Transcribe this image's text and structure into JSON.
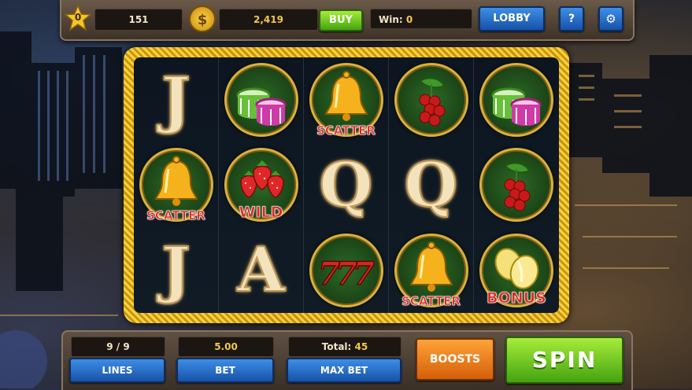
{
  "top_bar": {
    "level": "0",
    "stars": "151",
    "coins": "2,419",
    "buy_label": "BUY",
    "win_label": "Win:",
    "win_value": "0",
    "lobby_label": "LOBBY",
    "help_label": "?",
    "settings_icon": "gear-icon"
  },
  "reels": {
    "rows": [
      [
        "J",
        "chips",
        "bell",
        "cherries",
        "chips"
      ],
      [
        "bell",
        "strawberries",
        "Q",
        "Q",
        "cherries"
      ],
      [
        "J",
        "A",
        "sevens",
        "bell",
        "lemons"
      ]
    ],
    "labels": {
      "scatter": "SCATTER",
      "wild": "WILD",
      "bonus": "BONUS"
    }
  },
  "bottom_bar": {
    "lines_value": "9 / 9",
    "lines_label": "LINES",
    "bet_value": "5.00",
    "bet_label": "BET",
    "total_label": "Total:",
    "total_value": "45",
    "max_bet_label": "MAX BET",
    "boosts_label": "BOOSTS",
    "spin_label": "SPIN"
  },
  "colors": {
    "accent_blue": "#1e62c4",
    "spin_green": "#5ec21a",
    "boosts_orange": "#e8760f",
    "frame_gold": "#f2c42b"
  }
}
